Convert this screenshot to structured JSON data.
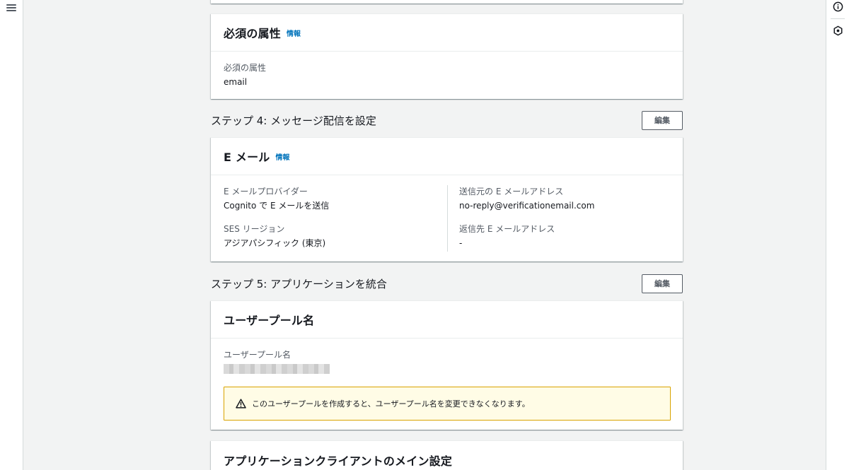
{
  "nav": {
    "menu_icon": "hamburger-menu-icon"
  },
  "tools": {
    "info_icon": "info-icon",
    "feedback_icon": "hexagon-icon"
  },
  "required_attributes": {
    "title": "必須の属性",
    "info": "情報",
    "label": "必須の属性",
    "value": "email"
  },
  "step4": {
    "title": "ステップ 4: メッセージ配信を設定",
    "edit": "編集",
    "card_title": "E メール",
    "info": "情報",
    "provider_label": "E メールプロバイダー",
    "provider_value": "Cognito で E メールを送信",
    "ses_label": "SES リージョン",
    "ses_value": "アジアパシフィック (東京)",
    "from_label": "送信元の E メールアドレス",
    "from_value": "no-reply@verificationemail.com",
    "reply_label": "返信先 E メールアドレス",
    "reply_value": "-"
  },
  "step5": {
    "title": "ステップ 5: アプリケーションを統合",
    "edit": "編集",
    "card_title": "ユーザープール名",
    "pool_label": "ユーザープール名",
    "alert_text": "このユーザープールを作成すると、ユーザープール名を変更できなくなります。",
    "app_client_title": "アプリケーションクライアントのメイン設定"
  },
  "colors": {
    "link": "#0073bb",
    "warning_border": "#d9a300",
    "warning_bg": "#fffce6"
  }
}
